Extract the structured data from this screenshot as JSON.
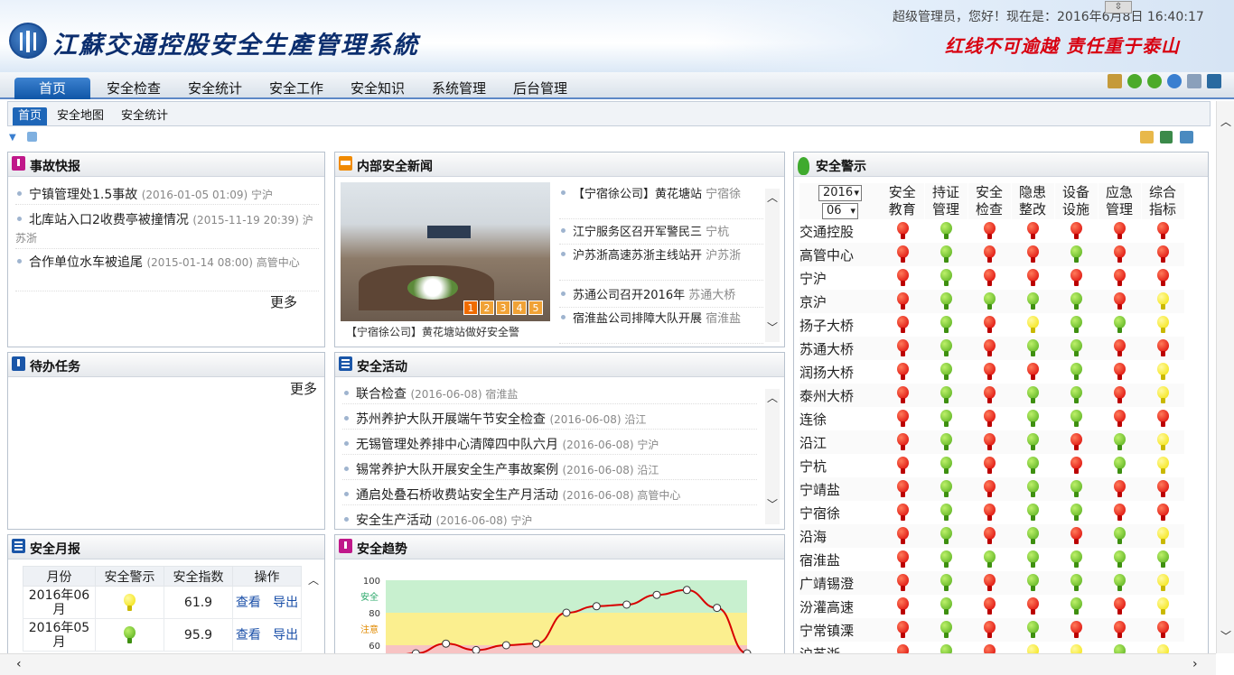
{
  "header": {
    "title": "江蘇交通控股安全生產管理系統",
    "greeting": "超级管理员，您好！现在是：2016年6月8日 16:40:17",
    "slogan": "红线不可逾越 责任重于泰山",
    "collapse": "⇳"
  },
  "nav": {
    "items": [
      "首页",
      "安全检查",
      "安全统计",
      "安全工作",
      "安全知识",
      "系统管理",
      "后台管理"
    ]
  },
  "subnav": {
    "items": [
      "首页",
      "安全地图",
      "安全统计"
    ]
  },
  "colors": {
    "accent": "#1e66b8",
    "red": "#d80000",
    "green": "#4faa18",
    "yellow": "#f2e000"
  },
  "accident": {
    "title": "事故快报",
    "items": [
      {
        "text": "宁镇管理处1.5事故",
        "meta": "(2016-01-05 01:09) 宁沪"
      },
      {
        "text": "北库站入口2收费亭被撞情况",
        "meta": "(2015-11-19 20:39) 沪苏浙"
      },
      {
        "text": "合作单位水车被追尾",
        "meta": "(2015-01-14 08:00) 高管中心"
      }
    ],
    "more": "更多"
  },
  "news": {
    "title": "内部安全新闻",
    "items": [
      {
        "text": "【宁宿徐公司】黄花塘站",
        "meta": "宁宿徐"
      },
      {
        "text": "江宁服务区召开军警民三",
        "meta": "宁杭"
      },
      {
        "text": "沪苏浙高速苏浙主线站开",
        "meta": "沪苏浙"
      },
      {
        "text": "苏通公司召开2016年",
        "meta": "苏通大桥"
      },
      {
        "text": "宿淮盐公司排障大队开展",
        "meta": "宿淮盐"
      }
    ],
    "caption": "【宁宿徐公司】黄花塘站做好安全警",
    "pages": [
      "1",
      "2",
      "3",
      "4",
      "5"
    ]
  },
  "todo": {
    "title": "待办任务",
    "more": "更多"
  },
  "activity": {
    "title": "安全活动",
    "items": [
      {
        "text": "联合检查",
        "meta": "(2016-06-08) 宿淮盐"
      },
      {
        "text": "苏州养护大队开展端午节安全检查",
        "meta": "(2016-06-08) 沿江"
      },
      {
        "text": "无锡管理处养排中心清障四中队六月",
        "meta": "(2016-06-08) 宁沪"
      },
      {
        "text": "锡常养护大队开展安全生产事故案例",
        "meta": "(2016-06-08) 沿江"
      },
      {
        "text": "通启处叠石桥收费站安全生产月活动",
        "meta": "(2016-06-08) 高管中心"
      },
      {
        "text": "安全生产活动",
        "meta": "(2016-06-08) 宁沪"
      }
    ]
  },
  "warning": {
    "title": "安全警示",
    "year": "2016",
    "month": "06",
    "headers": [
      "安全\n教育",
      "持证\n管理",
      "安全\n检查",
      "隐患\n整改",
      "设备\n设施",
      "应急\n管理",
      "综合\n指标"
    ],
    "rows": [
      {
        "name": "交通控股",
        "s": [
          "red",
          "green",
          "red",
          "red",
          "red",
          "red",
          "red"
        ]
      },
      {
        "name": "高管中心",
        "s": [
          "red",
          "green",
          "red",
          "red",
          "green",
          "red",
          "red"
        ]
      },
      {
        "name": "宁沪",
        "s": [
          "red",
          "green",
          "red",
          "red",
          "red",
          "red",
          "red"
        ]
      },
      {
        "name": "京沪",
        "s": [
          "red",
          "green",
          "green",
          "green",
          "green",
          "red",
          "yellow"
        ]
      },
      {
        "name": "扬子大桥",
        "s": [
          "red",
          "green",
          "red",
          "yellow",
          "green",
          "green",
          "yellow"
        ]
      },
      {
        "name": "苏通大桥",
        "s": [
          "red",
          "green",
          "red",
          "green",
          "green",
          "red",
          "red"
        ]
      },
      {
        "name": "润扬大桥",
        "s": [
          "red",
          "green",
          "red",
          "red",
          "green",
          "red",
          "yellow"
        ]
      },
      {
        "name": "泰州大桥",
        "s": [
          "red",
          "green",
          "red",
          "green",
          "green",
          "red",
          "yellow"
        ]
      },
      {
        "name": "连徐",
        "s": [
          "red",
          "green",
          "red",
          "green",
          "green",
          "red",
          "red"
        ]
      },
      {
        "name": "沿江",
        "s": [
          "red",
          "green",
          "red",
          "green",
          "red",
          "green",
          "yellow"
        ]
      },
      {
        "name": "宁杭",
        "s": [
          "red",
          "green",
          "red",
          "green",
          "red",
          "green",
          "yellow"
        ]
      },
      {
        "name": "宁靖盐",
        "s": [
          "red",
          "green",
          "red",
          "green",
          "green",
          "red",
          "red"
        ]
      },
      {
        "name": "宁宿徐",
        "s": [
          "red",
          "green",
          "red",
          "green",
          "green",
          "red",
          "red"
        ]
      },
      {
        "name": "沿海",
        "s": [
          "red",
          "green",
          "red",
          "green",
          "red",
          "green",
          "yellow"
        ]
      },
      {
        "name": "宿淮盐",
        "s": [
          "red",
          "green",
          "green",
          "green",
          "green",
          "green",
          "green"
        ]
      },
      {
        "name": "广靖锡澄",
        "s": [
          "red",
          "green",
          "red",
          "green",
          "green",
          "green",
          "yellow"
        ]
      },
      {
        "name": "汾灌高速",
        "s": [
          "red",
          "green",
          "red",
          "red",
          "green",
          "red",
          "yellow"
        ]
      },
      {
        "name": "宁常镇溧",
        "s": [
          "red",
          "green",
          "red",
          "green",
          "red",
          "red",
          "red"
        ]
      },
      {
        "name": "沪苏浙",
        "s": [
          "red",
          "green",
          "red",
          "yellow",
          "yellow",
          "green",
          "yellow"
        ]
      }
    ]
  },
  "monthly": {
    "title": "安全月报",
    "headers": [
      "月份",
      "安全警示",
      "安全指数",
      "操作"
    ],
    "rows": [
      {
        "month": "2016年06月",
        "signal": "yellow",
        "index": "61.9",
        "view": "查看",
        "export": "导出"
      },
      {
        "month": "2016年05月",
        "signal": "green",
        "index": "95.9",
        "view": "查看",
        "export": "导出"
      }
    ]
  },
  "trend": {
    "title": "安全趋势",
    "chart_data": {
      "type": "line",
      "series": [
        {
          "values": [
            52,
            55,
            61,
            57,
            60,
            61,
            80,
            84,
            85,
            91,
            94,
            83,
            55
          ]
        }
      ],
      "ylim": [
        50,
        100
      ],
      "yticks": [
        "100",
        "80",
        "60"
      ],
      "bands": [
        {
          "label": "安全",
          "color": "#c8f0cf"
        },
        {
          "label": "注意",
          "color": "#fbef8f"
        }
      ]
    }
  }
}
